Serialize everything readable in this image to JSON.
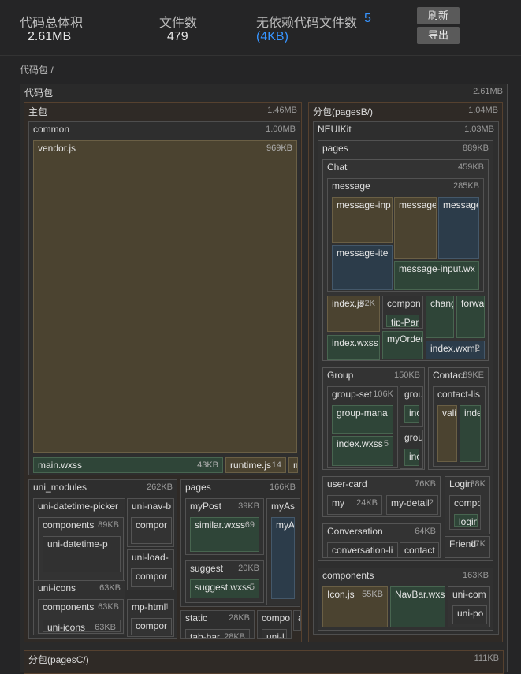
{
  "stats": {
    "total_label": "代码总体积",
    "total_value": "2.61MB",
    "files_label": "文件数",
    "files_value": "479",
    "unused_label": "无依赖代码文件数",
    "unused_count": "5",
    "unused_size": "(4KB)"
  },
  "buttons": {
    "refresh": "刷新",
    "export": "导出"
  },
  "breadcrumb": "代码包 /",
  "treemap": [
    {
      "name": "代码包",
      "size": "2.61MB"
    },
    {
      "name": "主包",
      "size": "1.46MB"
    },
    {
      "name": "common",
      "size": "1.00MB"
    },
    {
      "name": "vendor.js",
      "size": "969KB"
    },
    {
      "name": "main.wxss",
      "size": "43KB"
    },
    {
      "name": "runtime.js",
      "size": "14"
    },
    {
      "name": "m",
      "size": ""
    },
    {
      "name": "uni_modules",
      "size": "262KB"
    },
    {
      "name": "uni-datetime-picker",
      "size": ""
    },
    {
      "name": "components",
      "size": "89KB"
    },
    {
      "name": "uni-datetime-p",
      "size": ""
    },
    {
      "name": "uni-nav-b",
      "size": ""
    },
    {
      "name": "compor",
      "size": ""
    },
    {
      "name": "uni-load-",
      "size": ""
    },
    {
      "name": "compor",
      "size": ""
    },
    {
      "name": "uni-icons",
      "size": "63KB"
    },
    {
      "name": "components",
      "size": "63KB"
    },
    {
      "name": "uni-icons",
      "size": "63KB"
    },
    {
      "name": "mp-html",
      "size": "1"
    },
    {
      "name": "compor",
      "size": ""
    },
    {
      "name": "pages",
      "size": "166KB"
    },
    {
      "name": "myPost",
      "size": "39KB"
    },
    {
      "name": "similar.wxss",
      "size": "69"
    },
    {
      "name": "myAs",
      "size": ""
    },
    {
      "name": "myA",
      "size": ""
    },
    {
      "name": "suggest",
      "size": "20KB"
    },
    {
      "name": "suggest.wxss",
      "size": "5"
    },
    {
      "name": "static",
      "size": "28KB"
    },
    {
      "name": "tab-bar",
      "size": "28KB"
    },
    {
      "name": "compo",
      "size": ""
    },
    {
      "name": "uni-l",
      "size": ""
    },
    {
      "name": "a",
      "size": ""
    },
    {
      "name": "分包(pagesB/)",
      "size": "1.04MB"
    },
    {
      "name": "NEUIKit",
      "size": "1.03MB"
    },
    {
      "name": "pages",
      "size": "889KB"
    },
    {
      "name": "Chat",
      "size": "459KB"
    },
    {
      "name": "message",
      "size": "285KB"
    },
    {
      "name": "message-inp",
      "size": ""
    },
    {
      "name": "message",
      "size": ""
    },
    {
      "name": "message",
      "size": ""
    },
    {
      "name": "message-ite",
      "size": ""
    },
    {
      "name": "message-input.wx",
      "size": ""
    },
    {
      "name": "index.js",
      "size": "32K"
    },
    {
      "name": "compon",
      "size": ""
    },
    {
      "name": "tip-Pan",
      "size": ""
    },
    {
      "name": "chang",
      "size": ""
    },
    {
      "name": "forwa",
      "size": ""
    },
    {
      "name": "index.wxss",
      "size": ""
    },
    {
      "name": "myOrder",
      "size": ""
    },
    {
      "name": "index.wxml",
      "size": "2"
    },
    {
      "name": "Group",
      "size": "150KB"
    },
    {
      "name": "group-set",
      "size": "106K"
    },
    {
      "name": "group-mana",
      "size": ""
    },
    {
      "name": "index.wxss",
      "size": "5"
    },
    {
      "name": "grou",
      "size": ""
    },
    {
      "name": "inc",
      "size": ""
    },
    {
      "name": "grou",
      "size": ""
    },
    {
      "name": "inc",
      "size": ""
    },
    {
      "name": "Contact",
      "size": "89KE"
    },
    {
      "name": "contact-lis",
      "size": ""
    },
    {
      "name": "vali",
      "size": ""
    },
    {
      "name": "inde",
      "size": ""
    },
    {
      "name": "user-card",
      "size": "76KB"
    },
    {
      "name": "my",
      "size": "24KB"
    },
    {
      "name": "my-detail",
      "size": "2"
    },
    {
      "name": "Login",
      "size": "38K"
    },
    {
      "name": "compo",
      "size": ""
    },
    {
      "name": "login",
      "size": ""
    },
    {
      "name": "Conversation",
      "size": "64KB"
    },
    {
      "name": "conversation-li",
      "size": ""
    },
    {
      "name": "contact",
      "size": ""
    },
    {
      "name": "Friend",
      "size": "17K"
    },
    {
      "name": "components",
      "size": "163KB"
    },
    {
      "name": "Icon.js",
      "size": "55KB"
    },
    {
      "name": "NavBar.wxs",
      "size": ""
    },
    {
      "name": "uni-com",
      "size": ""
    },
    {
      "name": "uni-po",
      "size": ""
    },
    {
      "name": "分包(pagesC/)",
      "size": "111KB"
    }
  ]
}
